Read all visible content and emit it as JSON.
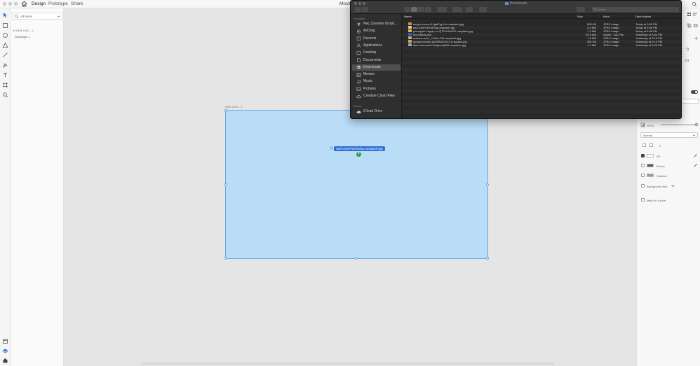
{
  "app": {
    "tabs": [
      "Design",
      "Prototype",
      "Share"
    ],
    "active_tab": "Design",
    "doc_title": "Mockup"
  },
  "layers": {
    "search_label": "All Items",
    "rows": [
      {
        "label": "▸ WEB 1920 – 1"
      },
      {
        "label": "Rectangle 1"
      }
    ]
  },
  "canvas": {
    "artboard_label": "Web 1920 – 1",
    "drag_file": "raul-C6wYNrG8Vbg-unsplash.jpg",
    "drag_badge": "+"
  },
  "props": {
    "opacity": "100%",
    "opacity_value": 1.0,
    "blend_mode": "Normal",
    "radius_value": "0",
    "fill_label": "Fill",
    "border_label": "Border",
    "shadow_label": "Shadow",
    "bg_blur_label": "Background Blur",
    "mark_export_label": "Mark for Export",
    "colors": {
      "fill": "#ffffff",
      "border": "#555555",
      "shadow": "#999999"
    }
  },
  "finder": {
    "title": "Downloads",
    "search_placeholder": "Search",
    "sidebar": {
      "favorites_header": "Favorites",
      "favorites": [
        {
          "label": "Net_Creative Dropb...",
          "icon": "dropbox-icon"
        },
        {
          "label": "AirDrop",
          "icon": "airdrop-icon"
        },
        {
          "label": "Recents",
          "icon": "recents-icon"
        },
        {
          "label": "Applications",
          "icon": "applications-icon"
        },
        {
          "label": "Desktop",
          "icon": "desktop-icon"
        },
        {
          "label": "Documents",
          "icon": "documents-icon"
        },
        {
          "label": "Downloads",
          "icon": "downloads-icon",
          "selected": true
        },
        {
          "label": "Movies",
          "icon": "movies-icon"
        },
        {
          "label": "Music",
          "icon": "music-icon"
        },
        {
          "label": "Pictures",
          "icon": "pictures-icon"
        },
        {
          "label": "Creative Cloud Files",
          "icon": "creative-cloud-icon"
        }
      ],
      "icloud_header": "iCloud",
      "icloud": [
        {
          "label": "iCloud Drive",
          "icon": "icloud-icon"
        }
      ]
    },
    "columns": {
      "name": "Name",
      "size": "Size",
      "kind": "Kind",
      "date": "Date Added"
    },
    "files": [
      {
        "name": "sergio-souza-r11gaiFqp-LA-unsplash.jpg",
        "size": "808 KB",
        "kind": "JPEG image",
        "date": "Today at 9:50 PM",
        "thumb": "#d98a3c"
      },
      {
        "name": "raul-C6wYNrG8Vbg-unsplash.jpg",
        "size": "5.3 MB",
        "kind": "JPEG image",
        "date": "Today at 9:48 PM",
        "thumb": "#c9c9c9"
      },
      {
        "name": "pineapple-supply-co-Q7PcHNhRO-unsplash.jpg",
        "size": "1.3 MB",
        "kind": "JPEG image",
        "date": "Today at 8:48 PM",
        "thumb": "#e0b63a"
      },
      {
        "name": "Mountains.psd",
        "size": "29.9 MB",
        "kind": "Adobe...hop File",
        "date": "Yesterday at 3:54 PM",
        "thumb": "#3a5fa8"
      },
      {
        "name": "andrew-neel-_7tnlAn-ZtA-unsplash.jpg",
        "size": "1.5 MB",
        "kind": "JPEG image",
        "date": "Yesterday at 9:15 PM",
        "thumb": "#b0b0b0"
      },
      {
        "name": "giorgio-trovato-p0OlRAAYXLY-unsplash.jpg",
        "size": "452 KB",
        "kind": "JPEG image",
        "date": "Yesterday at 9:13 PM",
        "thumb": "#e5a02e"
      },
      {
        "name": "dino-reichmuth-A5qbuduj545-unsplash.jpg",
        "size": "1.1 MB",
        "kind": "JPEG image",
        "date": "Yesterday at 9:08 PM",
        "thumb": "#8aa6c8"
      }
    ]
  }
}
